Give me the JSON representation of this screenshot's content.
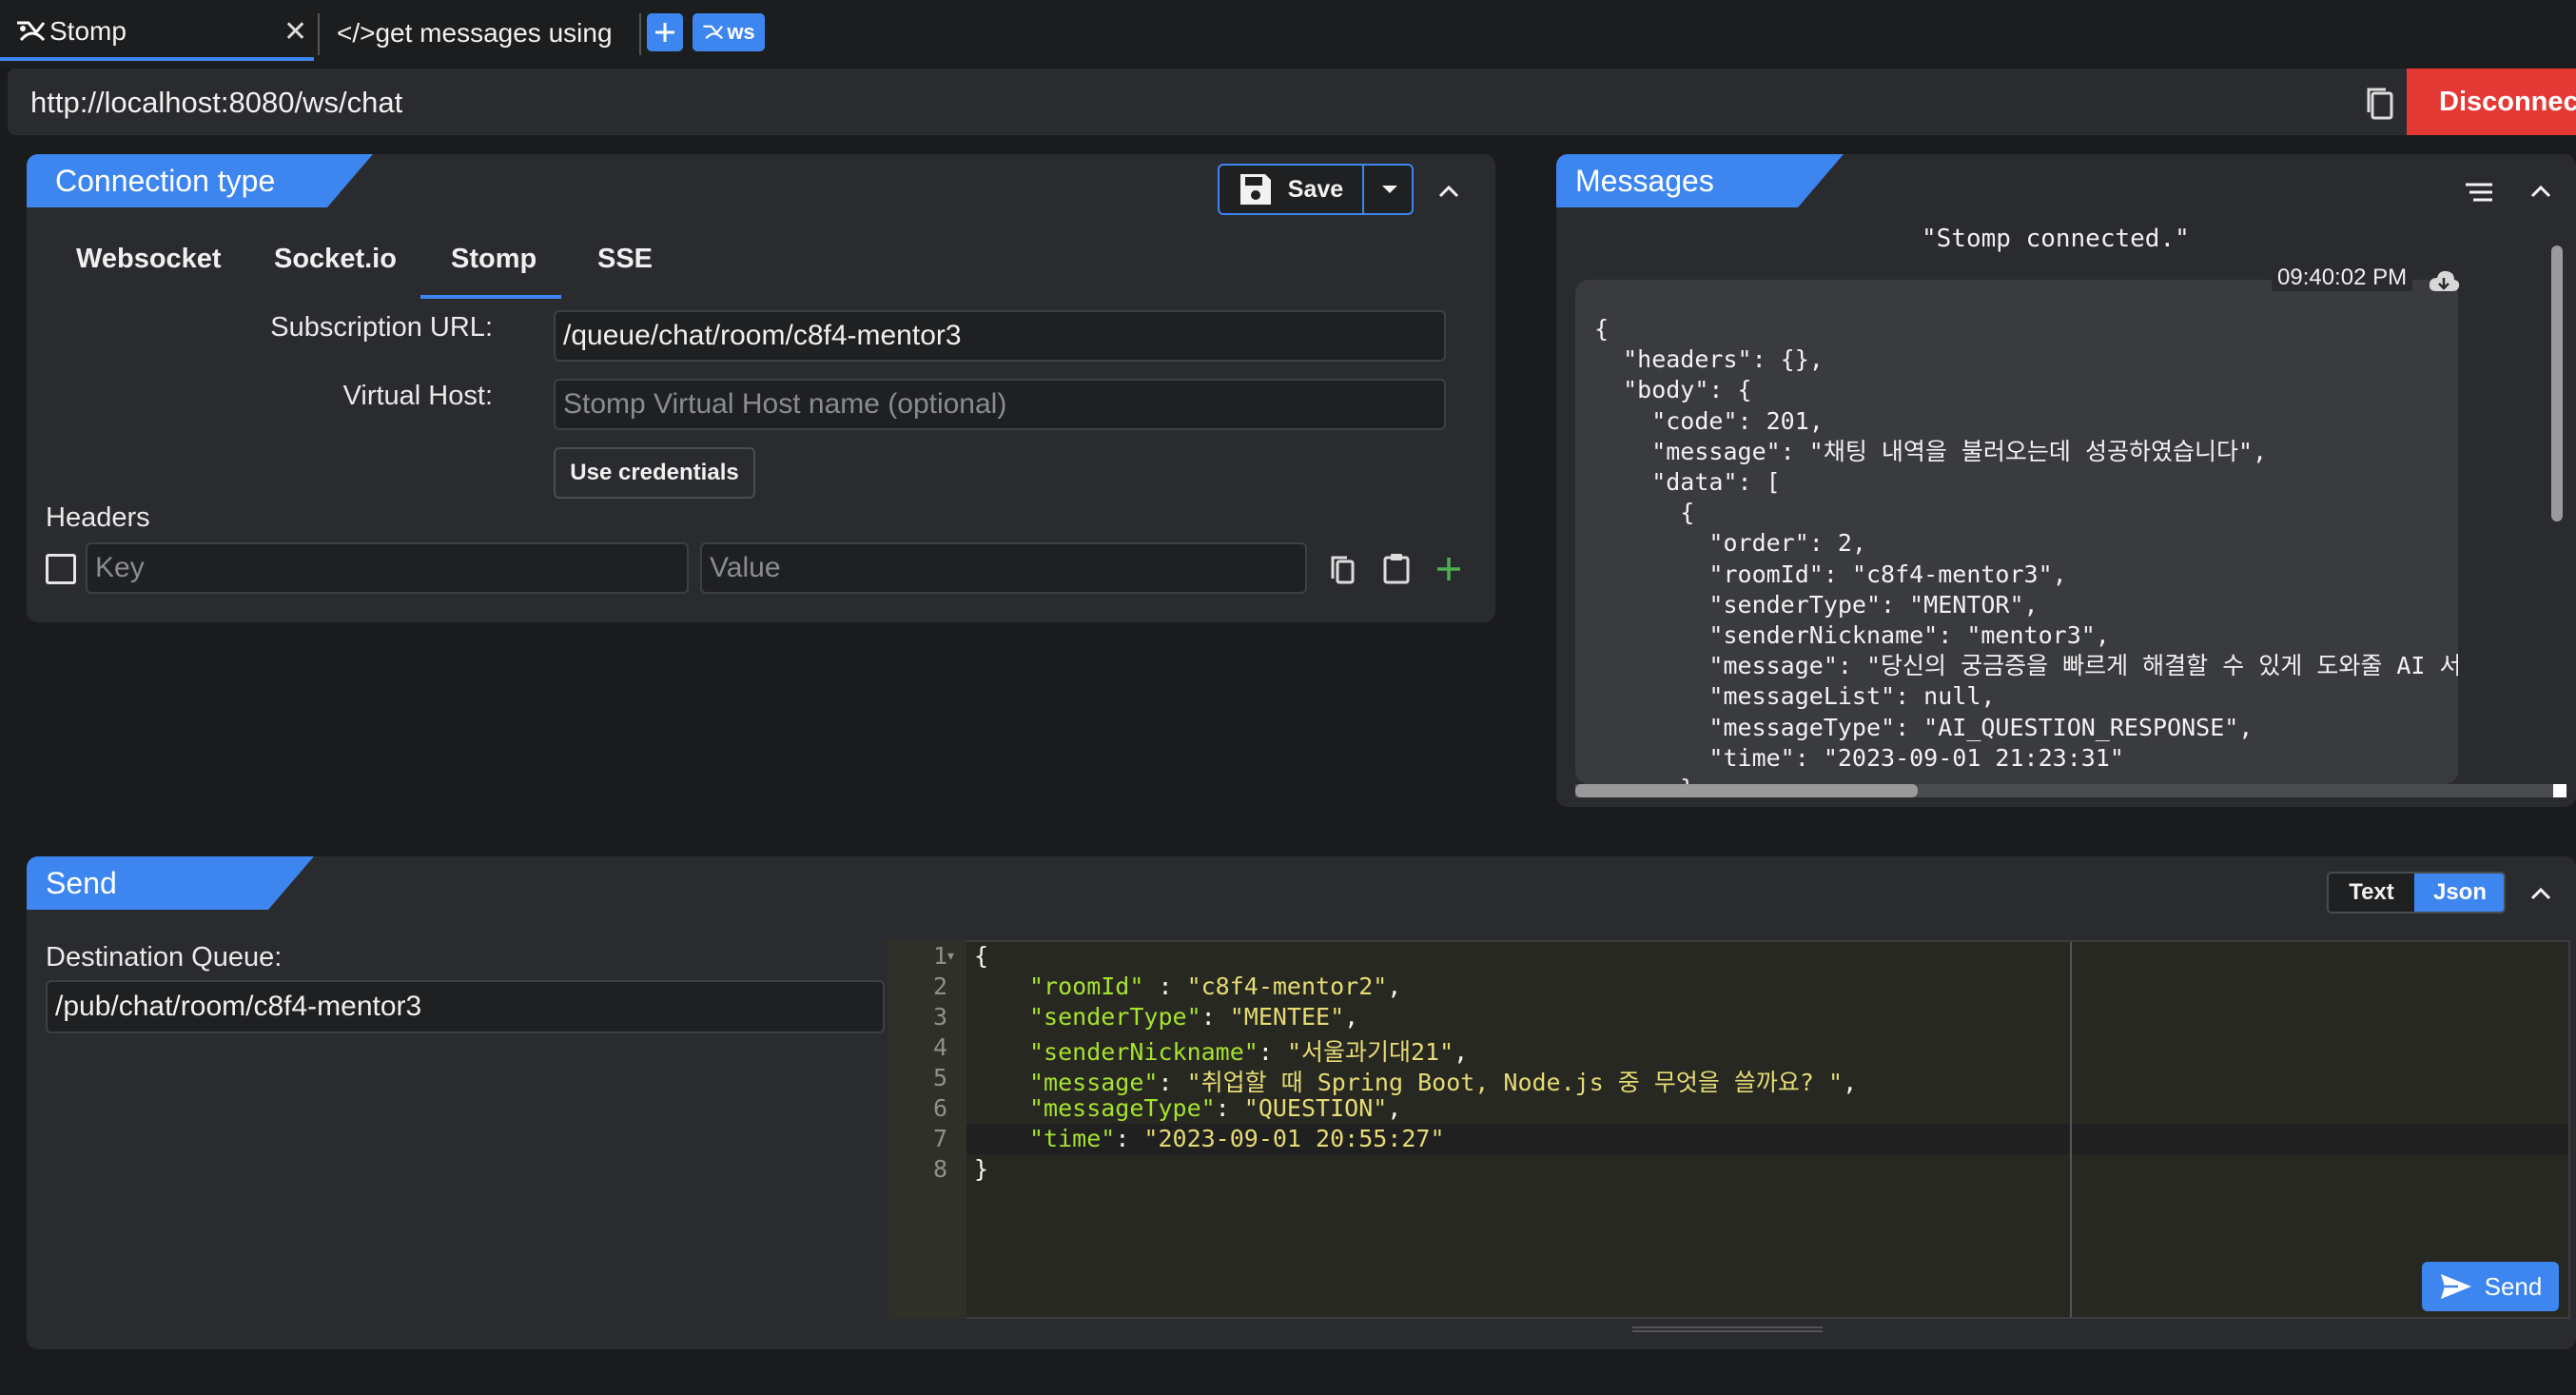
{
  "tabs": [
    {
      "label": "Stomp",
      "active": true
    },
    {
      "label": "</>get messages using",
      "active": false
    }
  ],
  "tab_buttons": {
    "add_icon": "plus-icon",
    "ws_label": "ws"
  },
  "url": "http://localhost:8080/ws/chat",
  "disconnect_label": "Disconnect",
  "connection": {
    "title": "Connection type",
    "save_label": "Save",
    "types": [
      "Websocket",
      "Socket.io",
      "Stomp",
      "SSE"
    ],
    "selected_type": "Stomp",
    "subscription_label": "Subscription URL:",
    "subscription_value": "/queue/chat/room/c8f4-mentor3",
    "virtual_host_label": "Virtual Host:",
    "virtual_host_placeholder": "Stomp Virtual Host name (optional)",
    "use_credentials_label": "Use credentials",
    "headers_label": "Headers",
    "key_placeholder": "Key",
    "value_placeholder": "Value"
  },
  "messages": {
    "title": "Messages",
    "status_message": "\"Stomp connected.\"",
    "time": "09:40:02 PM",
    "json_lines": [
      "{",
      "  \"headers\": {},",
      "  \"body\": {",
      "    \"code\": 201,",
      "    \"message\": \"채팅 내역을 불러오는데 성공하였습니다\",",
      "    \"data\": [",
      "      {",
      "        \"order\": 2,",
      "        \"roomId\": \"c8f4-mentor3\",",
      "        \"senderType\": \"MENTOR\",",
      "        \"senderNickname\": \"mentor3\",",
      "        \"message\": \"당신의 궁금증을 빠르게 해결할 수 있게 도와줄 AI 서포",
      "        \"messageList\": null,",
      "        \"messageType\": \"AI_QUESTION_RESPONSE\",",
      "        \"time\": \"2023-09-01 21:23:31\"",
      "      },"
    ]
  },
  "send": {
    "title": "Send",
    "mode_text": "Text",
    "mode_json": "Json",
    "selected_mode": "Json",
    "destination_label": "Destination Queue:",
    "destination_value": "/pub/chat/room/c8f4-mentor3",
    "send_label": "Send",
    "line_numbers": [
      "1",
      "2",
      "3",
      "4",
      "5",
      "6",
      "7",
      "8"
    ],
    "code": {
      "open": "{",
      "l2k": "\"roomId\"",
      "l2s": " : ",
      "l2v": "\"c8f4-mentor2\"",
      "l2e": ",",
      "l3k": "\"senderType\"",
      "l3s": ": ",
      "l3v": "\"MENTEE\"",
      "l3e": ",",
      "l4k": "\"senderNickname\"",
      "l4s": ": ",
      "l4v": "\"서울과기대21\"",
      "l4e": ",",
      "l5k": "\"message\"",
      "l5s": ": ",
      "l5v": "\"취업할 때 Spring Boot, Node.js 중 무엇을 쓸까요? \"",
      "l5e": ",",
      "l6k": "\"messageType\"",
      "l6s": ": ",
      "l6v": "\"QUESTION\"",
      "l6e": ",",
      "l7k": "\"time\"",
      "l7s": ": ",
      "l7v": "\"2023-09-01 20:55:27\"",
      "close": "}"
    }
  },
  "colors": {
    "accent": "#3d86f0",
    "danger": "#e53935",
    "add": "#4caf50"
  }
}
